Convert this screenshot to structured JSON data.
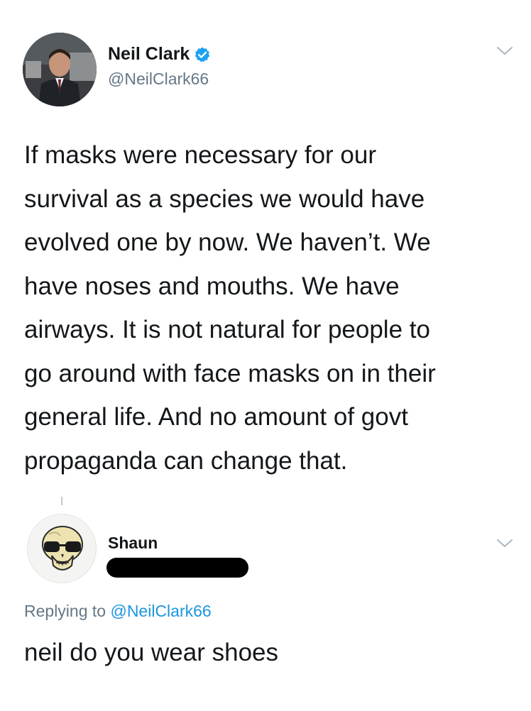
{
  "tweet": {
    "author": {
      "name": "Neil Clark",
      "handle": "@NeilClark66",
      "verified": true
    },
    "text": "If masks were necessary for our\nsurvival as a species we would have\nevolved one by now. We haven’t. We\nhave noses and mouths. We have\nairways. It is not natural for people to\ngo around with face masks on in their\ngeneral life. And no amount of govt\npropaganda can change that."
  },
  "reply": {
    "author": {
      "name": "Shaun"
    },
    "replying_prefix": "Replying to ",
    "replying_to": "@NeilClark66",
    "text": "neil do you wear shoes"
  },
  "icons": {
    "verified": "verified-badge-icon",
    "menu": "chevron-down-icon",
    "reply_avatar": "skull-with-sunglasses"
  },
  "colors": {
    "text": "#14171a",
    "secondary": "#657786",
    "link": "#1b95e0",
    "verified": "#1da1f2"
  }
}
